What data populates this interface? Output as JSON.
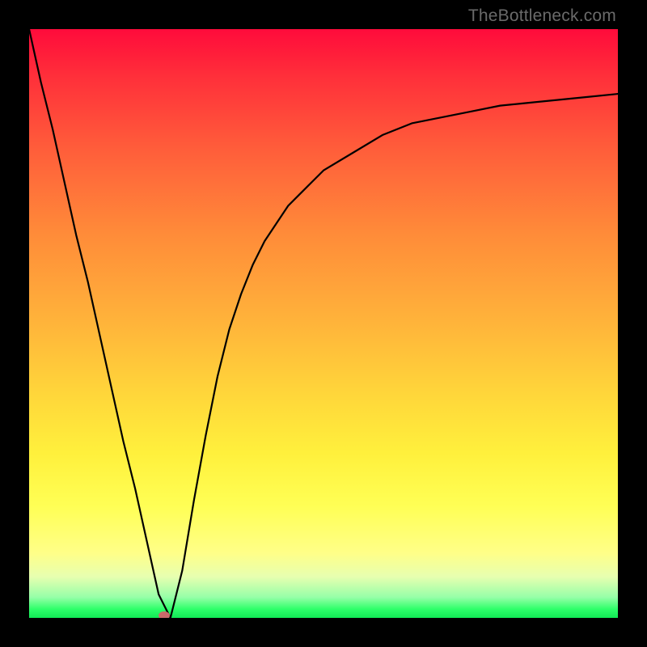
{
  "watermark": {
    "text": "TheBottleneck.com"
  },
  "chart_data": {
    "type": "line",
    "title": "",
    "xlabel": "",
    "ylabel": "",
    "x": [
      0.0,
      0.02,
      0.04,
      0.06,
      0.08,
      0.1,
      0.12,
      0.14,
      0.16,
      0.18,
      0.2,
      0.22,
      0.24,
      0.26,
      0.28,
      0.3,
      0.32,
      0.34,
      0.36,
      0.38,
      0.4,
      0.42,
      0.44,
      0.46,
      0.48,
      0.5,
      0.55,
      0.6,
      0.65,
      0.7,
      0.75,
      0.8,
      0.85,
      0.9,
      0.95,
      1.0
    ],
    "values": [
      1.0,
      0.91,
      0.83,
      0.74,
      0.65,
      0.57,
      0.48,
      0.39,
      0.3,
      0.22,
      0.13,
      0.04,
      0.0,
      0.08,
      0.2,
      0.31,
      0.41,
      0.49,
      0.55,
      0.6,
      0.64,
      0.67,
      0.7,
      0.72,
      0.74,
      0.76,
      0.79,
      0.82,
      0.84,
      0.85,
      0.86,
      0.87,
      0.875,
      0.88,
      0.885,
      0.89
    ],
    "xlim": [
      0.0,
      1.0
    ],
    "ylim": [
      0.0,
      1.0
    ],
    "min_point": {
      "x": 0.23,
      "y": 0.0
    },
    "grid": false,
    "legend": false,
    "style": {
      "line_color": "#000000",
      "line_width": 2,
      "background": "red-yellow-green vertical gradient",
      "frame_color": "#000000"
    }
  }
}
